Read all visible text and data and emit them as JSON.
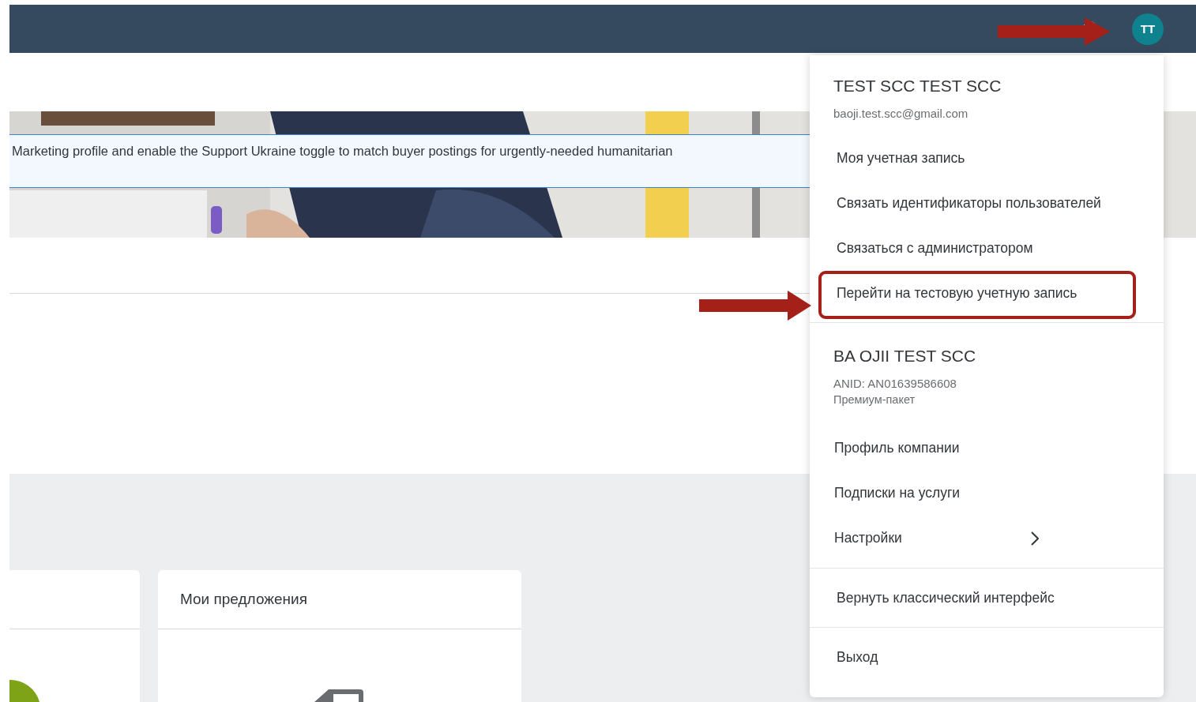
{
  "header": {
    "avatar": "TT"
  },
  "banner": {
    "message": "Marketing profile and enable the Support Ukraine toggle to match buyer postings for urgently-needed humanitarian"
  },
  "cards": [
    {
      "kind": "chart"
    },
    {
      "kind": "empty",
      "title": "Мои предложения"
    }
  ],
  "user_menu": {
    "user": {
      "name": "TEST SCC TEST SCC",
      "email": "baoji.test.scc@gmail.com"
    },
    "account_items": [
      {
        "label": "Моя учетная запись",
        "highlighted": false
      },
      {
        "label": "Связать идентификаторы пользователей",
        "highlighted": false
      },
      {
        "label": "Связаться с администратором",
        "highlighted": false
      },
      {
        "label": "Перейти на тестовую учетную запись",
        "highlighted": true
      }
    ],
    "company": {
      "name": "BA OJII TEST SCC",
      "anid": "ANID: AN01639586608",
      "plan": "Премиум-пакет"
    },
    "company_items": [
      {
        "label": "Профиль компании",
        "submenu": false
      },
      {
        "label": "Подписки на услуги",
        "submenu": false
      },
      {
        "label": "Настройки",
        "submenu": true
      }
    ],
    "classic": "Вернуть классический интерфейс",
    "logout": "Выход"
  }
}
